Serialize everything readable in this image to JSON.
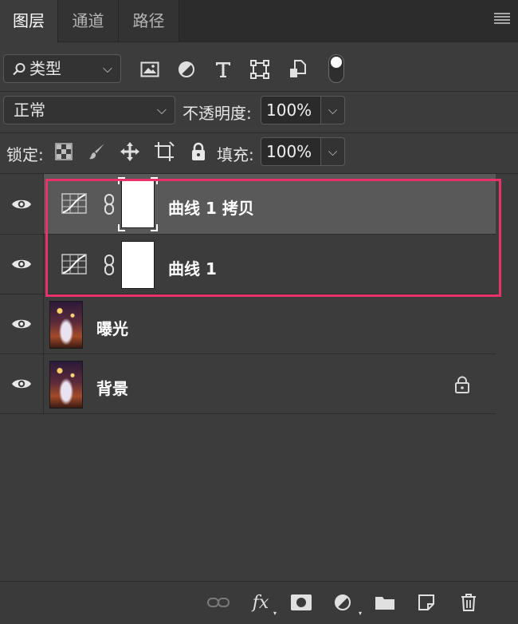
{
  "tabs": [
    {
      "label": "图层",
      "active": true
    },
    {
      "label": "通道",
      "active": false
    },
    {
      "label": "路径",
      "active": false
    }
  ],
  "filter": {
    "kind_label": "类型",
    "buttons": [
      "image-filter-icon",
      "adjustment-filter-icon",
      "type-filter-icon",
      "shape-filter-icon",
      "smart-object-filter-icon"
    ]
  },
  "blend": {
    "mode": "正常",
    "opacity_label": "不透明度:",
    "opacity_value": "100%"
  },
  "lock": {
    "label": "锁定:",
    "fill_label": "填充:",
    "fill_value": "100%"
  },
  "layers": [
    {
      "name": "曲线 1 拷贝",
      "type": "curves-adjustment",
      "selected": true,
      "visible": true
    },
    {
      "name": "曲线 1",
      "type": "curves-adjustment",
      "selected": false,
      "visible": true
    },
    {
      "name": "曝光",
      "type": "photo",
      "selected": false,
      "visible": true
    },
    {
      "name": "背景",
      "type": "photo",
      "selected": false,
      "visible": true,
      "locked": true
    }
  ],
  "colors": {
    "highlight": "#e8326a",
    "panel_bg": "#3c3c3c",
    "selected_row": "#595959"
  }
}
